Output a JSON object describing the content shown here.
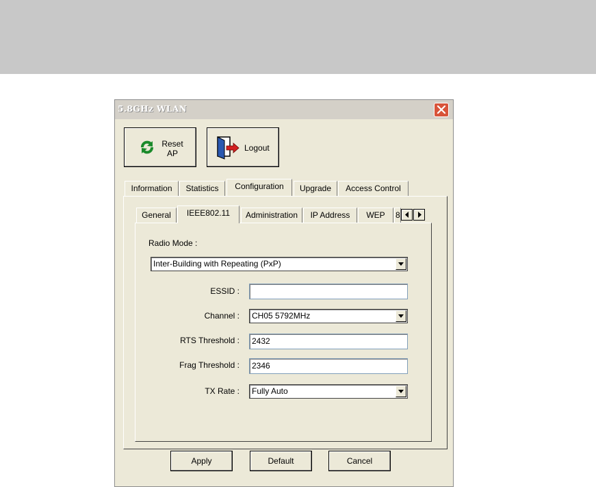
{
  "window": {
    "title": "5.8GHz WLAN"
  },
  "toolbar": {
    "reset_label_1": "Reset",
    "reset_label_2": "AP",
    "logout_label": "Logout"
  },
  "tabs": [
    {
      "label": "Information",
      "selected": false
    },
    {
      "label": "Statistics",
      "selected": false
    },
    {
      "label": "Configuration",
      "selected": true
    },
    {
      "label": "Upgrade",
      "selected": false
    },
    {
      "label": "Access Control",
      "selected": false
    }
  ],
  "subtabs": [
    {
      "label": "General",
      "selected": false
    },
    {
      "label": "IEEE802.11",
      "selected": true
    },
    {
      "label": "Administration",
      "selected": false
    },
    {
      "label": "IP Address",
      "selected": false
    },
    {
      "label": "WEP",
      "selected": false
    },
    {
      "label": "8",
      "selected": false
    }
  ],
  "form": {
    "radio_mode_label": "Radio Mode :",
    "radio_mode_value": "Inter-Building with Repeating (PxP)",
    "essid_label": "ESSID :",
    "essid_value": "",
    "channel_label": "Channel :",
    "channel_value": "CH05 5792MHz",
    "rts_label": "RTS Threshold :",
    "rts_value": "2432",
    "frag_label": "Frag Threshold :",
    "frag_value": "2346",
    "txrate_label": "TX Rate :",
    "txrate_value": "Fully Auto"
  },
  "buttons": {
    "apply": "Apply",
    "default": "Default",
    "cancel": "Cancel"
  },
  "icons": {
    "close": "close-icon",
    "reset": "refresh-icon",
    "logout": "door-exit-icon",
    "scroll_left": "scroll-left-icon",
    "scroll_right": "scroll-right-icon",
    "dropdown": "chevron-down-icon"
  }
}
